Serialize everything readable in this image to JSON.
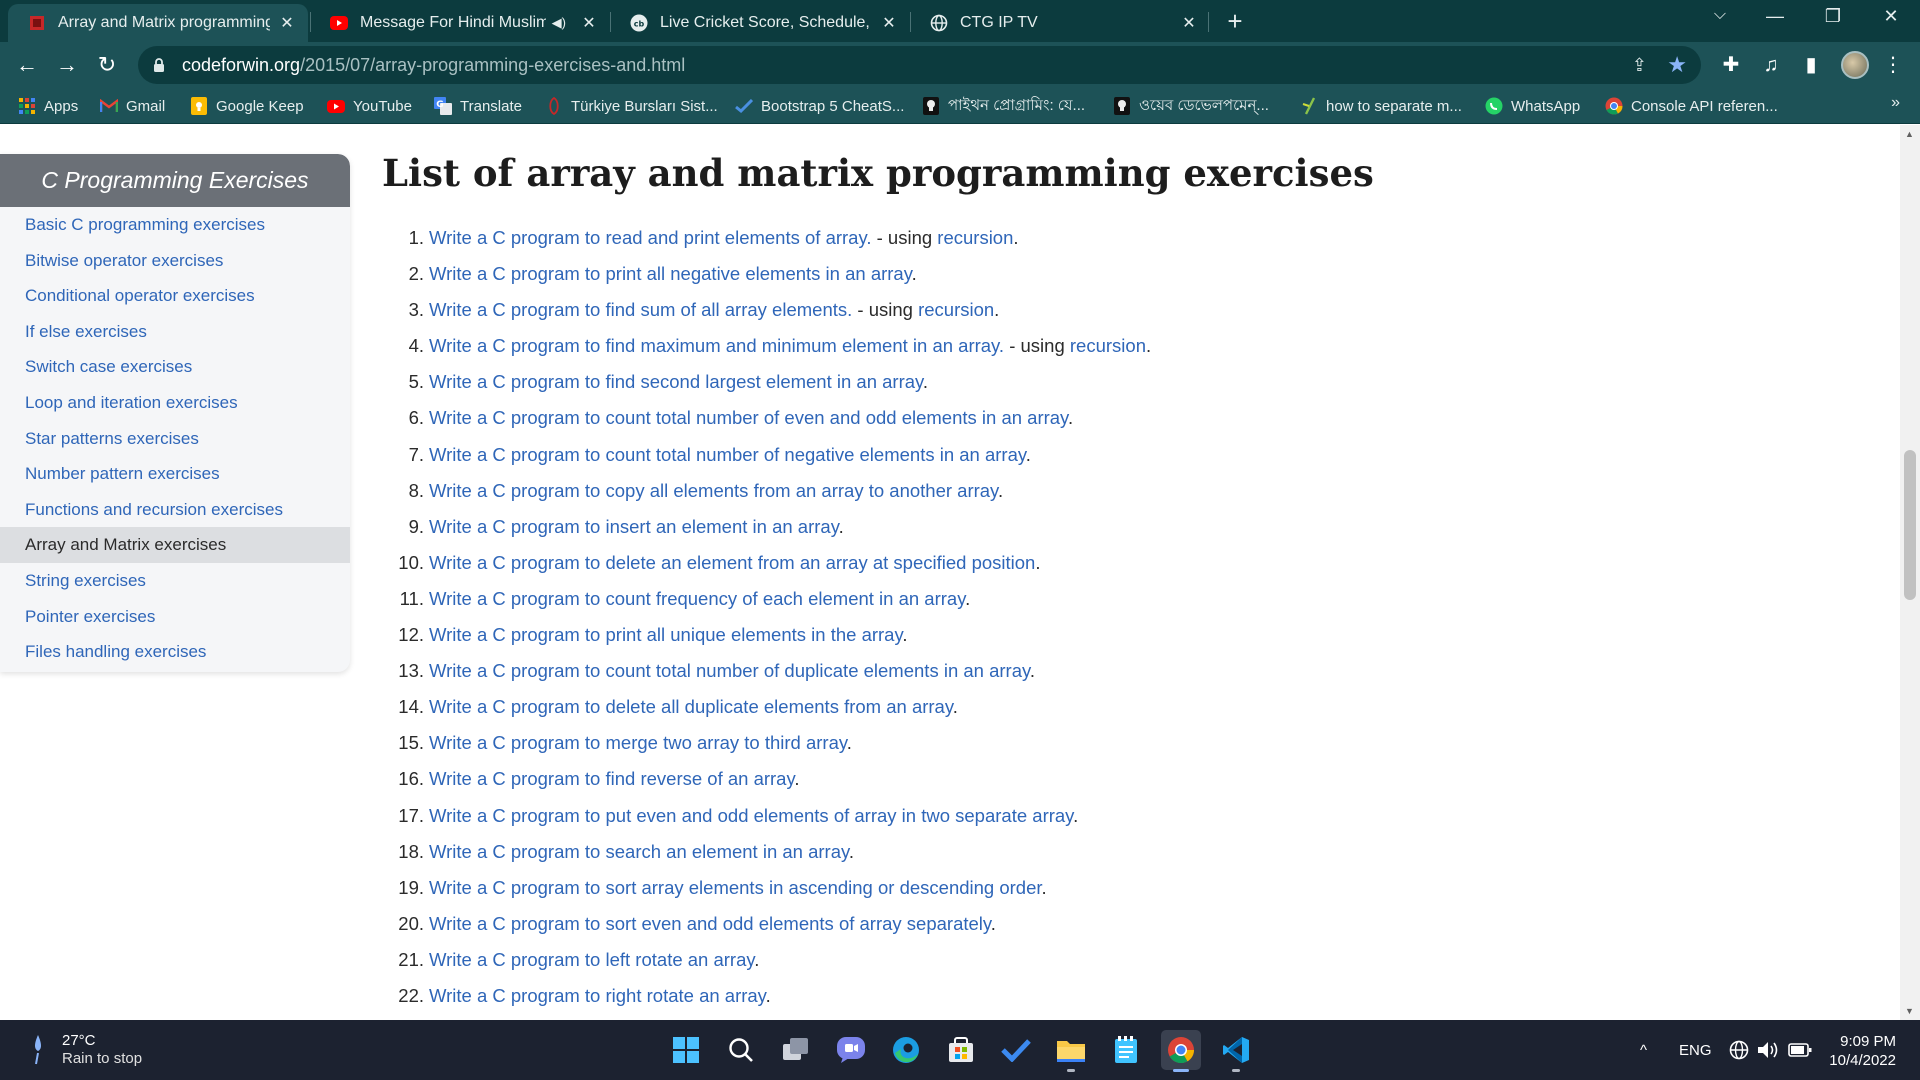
{
  "browser": {
    "tabs": [
      {
        "title": "Array and Matrix programming e",
        "active": true
      },
      {
        "title": "Message For Hindi Muslims",
        "active": false
      },
      {
        "title": "Live Cricket Score, Schedule, Late",
        "active": false
      },
      {
        "title": "CTG IP TV",
        "active": false
      }
    ],
    "url_domain": "codeforwin.org",
    "url_path": "/2015/07/array-programming-exercises-and.html",
    "bookmarks": [
      {
        "label": "Apps",
        "icon": "apps-grid-icon"
      },
      {
        "label": "Gmail",
        "icon": "gmail-icon"
      },
      {
        "label": "Google Keep",
        "icon": "keep-icon"
      },
      {
        "label": "YouTube",
        "icon": "youtube-icon"
      },
      {
        "label": "Translate",
        "icon": "translate-icon"
      },
      {
        "label": "Türkiye Bursları Sist...",
        "icon": "bookmark-icon"
      },
      {
        "label": "Bootstrap 5 CheatS...",
        "icon": "bookmark-icon"
      },
      {
        "label": "পাইথন প্রোগ্রামিং: যে...",
        "icon": "bookmark-icon"
      },
      {
        "label": "ওয়েব ডেভেলপমেন্...",
        "icon": "bookmark-icon"
      },
      {
        "label": "how to separate m...",
        "icon": "bookmark-icon"
      },
      {
        "label": "WhatsApp",
        "icon": "whatsapp-icon"
      },
      {
        "label": "Console API referen...",
        "icon": "chrome-icon"
      }
    ],
    "bookmarks_more": "»",
    "new_tab": "+",
    "colors": {
      "frame": "#0c3b3e",
      "toolbar": "#1d5257"
    }
  },
  "sidebar": {
    "title": "C Programming Exercises",
    "items": [
      {
        "label": "Basic C programming exercises"
      },
      {
        "label": "Bitwise operator exercises"
      },
      {
        "label": "Conditional operator exercises"
      },
      {
        "label": "If else exercises"
      },
      {
        "label": "Switch case exercises"
      },
      {
        "label": "Loop and iteration exercises"
      },
      {
        "label": "Star patterns exercises"
      },
      {
        "label": "Number pattern exercises"
      },
      {
        "label": "Functions and recursion exercises"
      },
      {
        "label": "Array and Matrix exercises",
        "active": true
      },
      {
        "label": "String exercises"
      },
      {
        "label": "Pointer exercises"
      },
      {
        "label": "Files handling exercises"
      }
    ]
  },
  "main": {
    "heading": "List of array and matrix programming exercises",
    "exercises": [
      {
        "num": "1.",
        "text": "Write a C program to read and print elements of array.",
        "extra": " - using ",
        "rec": "recursion",
        "end": "."
      },
      {
        "num": "2.",
        "text": "Write a C program to print all negative elements in an array",
        "end": "."
      },
      {
        "num": "3.",
        "text": "Write a C program to find sum of all array elements.",
        "extra": " - using ",
        "rec": "recursion",
        "end": "."
      },
      {
        "num": "4.",
        "text": "Write a C program to find maximum and minimum element in an array.",
        "extra": " - using ",
        "rec": "recursion",
        "end": "."
      },
      {
        "num": "5.",
        "text": "Write a C program to find second largest element in an array",
        "end": "."
      },
      {
        "num": "6.",
        "text": "Write a C program to count total number of even and odd elements in an array",
        "end": "."
      },
      {
        "num": "7.",
        "text": "Write a C program to count total number of negative elements in an array",
        "end": "."
      },
      {
        "num": "8.",
        "text": "Write a C program to copy all elements from an array to another array",
        "end": "."
      },
      {
        "num": "9.",
        "text": "Write a C program to insert an element in an array",
        "end": "."
      },
      {
        "num": "10.",
        "text": "Write a C program to delete an element from an array at specified position",
        "end": "."
      },
      {
        "num": "11.",
        "text": "Write a C program to count frequency of each element in an array",
        "end": "."
      },
      {
        "num": "12.",
        "text": "Write a C program to print all unique elements in the array",
        "end": "."
      },
      {
        "num": "13.",
        "text": "Write a C program to count total number of duplicate elements in an array",
        "end": "."
      },
      {
        "num": "14.",
        "text": "Write a C program to delete all duplicate elements from an array",
        "end": "."
      },
      {
        "num": "15.",
        "text": "Write a C program to merge two array to third array",
        "end": "."
      },
      {
        "num": "16.",
        "text": "Write a C program to find reverse of an array",
        "end": "."
      },
      {
        "num": "17.",
        "text": "Write a C program to put even and odd elements of array in two separate array",
        "end": "."
      },
      {
        "num": "18.",
        "text": "Write a C program to search an element in an array",
        "end": "."
      },
      {
        "num": "19.",
        "text": "Write a C program to sort array elements in ascending or descending order",
        "end": "."
      },
      {
        "num": "20.",
        "text": "Write a C program to sort even and odd elements of array separately",
        "end": "."
      },
      {
        "num": "21.",
        "text": "Write a C program to left rotate an array",
        "end": "."
      },
      {
        "num": "22.",
        "text": "Write a C program to right rotate an array",
        "end": "."
      }
    ],
    "colors": {
      "link": "#2f66b8",
      "text": "#2b2b2b"
    }
  },
  "taskbar": {
    "weather_temp": "27°C",
    "weather_text": "Rain to stop",
    "apps": [
      "windows-start-icon",
      "search-icon",
      "task-view-icon",
      "chat-icon",
      "edge-icon",
      "store-icon",
      "todo-icon",
      "file-explorer-icon",
      "notepad-icon",
      "chrome-icon",
      "vscode-icon"
    ],
    "language": "ENG",
    "time": "9:09 PM",
    "date": "10/4/2022"
  }
}
